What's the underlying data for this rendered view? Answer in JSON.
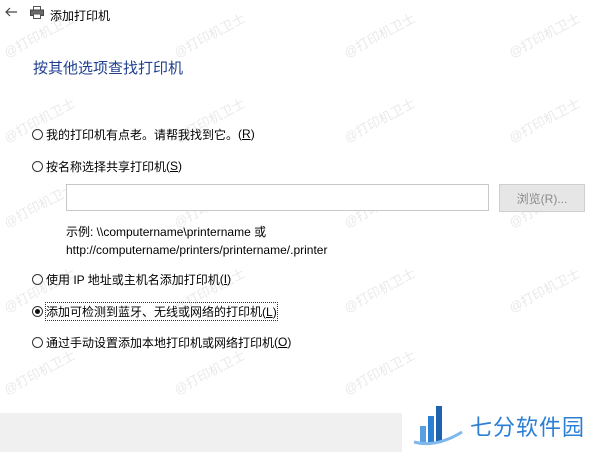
{
  "window": {
    "title": "添加打印机",
    "back_icon": "back-arrow-icon",
    "app_icon": "printer-icon"
  },
  "heading": "按其他选项查找打印机",
  "options": [
    {
      "label": "我的打印机有点老。请帮我找到它。",
      "key": "(R)",
      "key_letter": "R",
      "checked": false
    },
    {
      "label": "按名称选择共享打印机",
      "key": "(S)",
      "key_letter": "S",
      "checked": false
    },
    {
      "label": "使用 IP 地址或主机名添加打印机",
      "key": "(I)",
      "key_letter": "I",
      "checked": false
    },
    {
      "label": "添加可检测到蓝牙、无线或网络的打印机",
      "key": "(L)",
      "key_letter": "L",
      "checked": true
    },
    {
      "label": "通过手动设置添加本地打印机或网络打印机",
      "key": "(O)",
      "key_letter": "O",
      "checked": false
    }
  ],
  "share_name_input": {
    "value": "",
    "placeholder": ""
  },
  "browse_button": "浏览(R)...",
  "example": {
    "line1": "示例: \\\\computername\\printername 或",
    "line2": "http://computername/printers/printername/.printer"
  },
  "watermark": "@打印机卫士",
  "branding": {
    "logo_icon": "qifen-logo-icon",
    "text": "七分软件园",
    "color": "#2b7fd4"
  },
  "colors": {
    "heading": "#1f3f8f",
    "footer": "#f0f0f0"
  }
}
